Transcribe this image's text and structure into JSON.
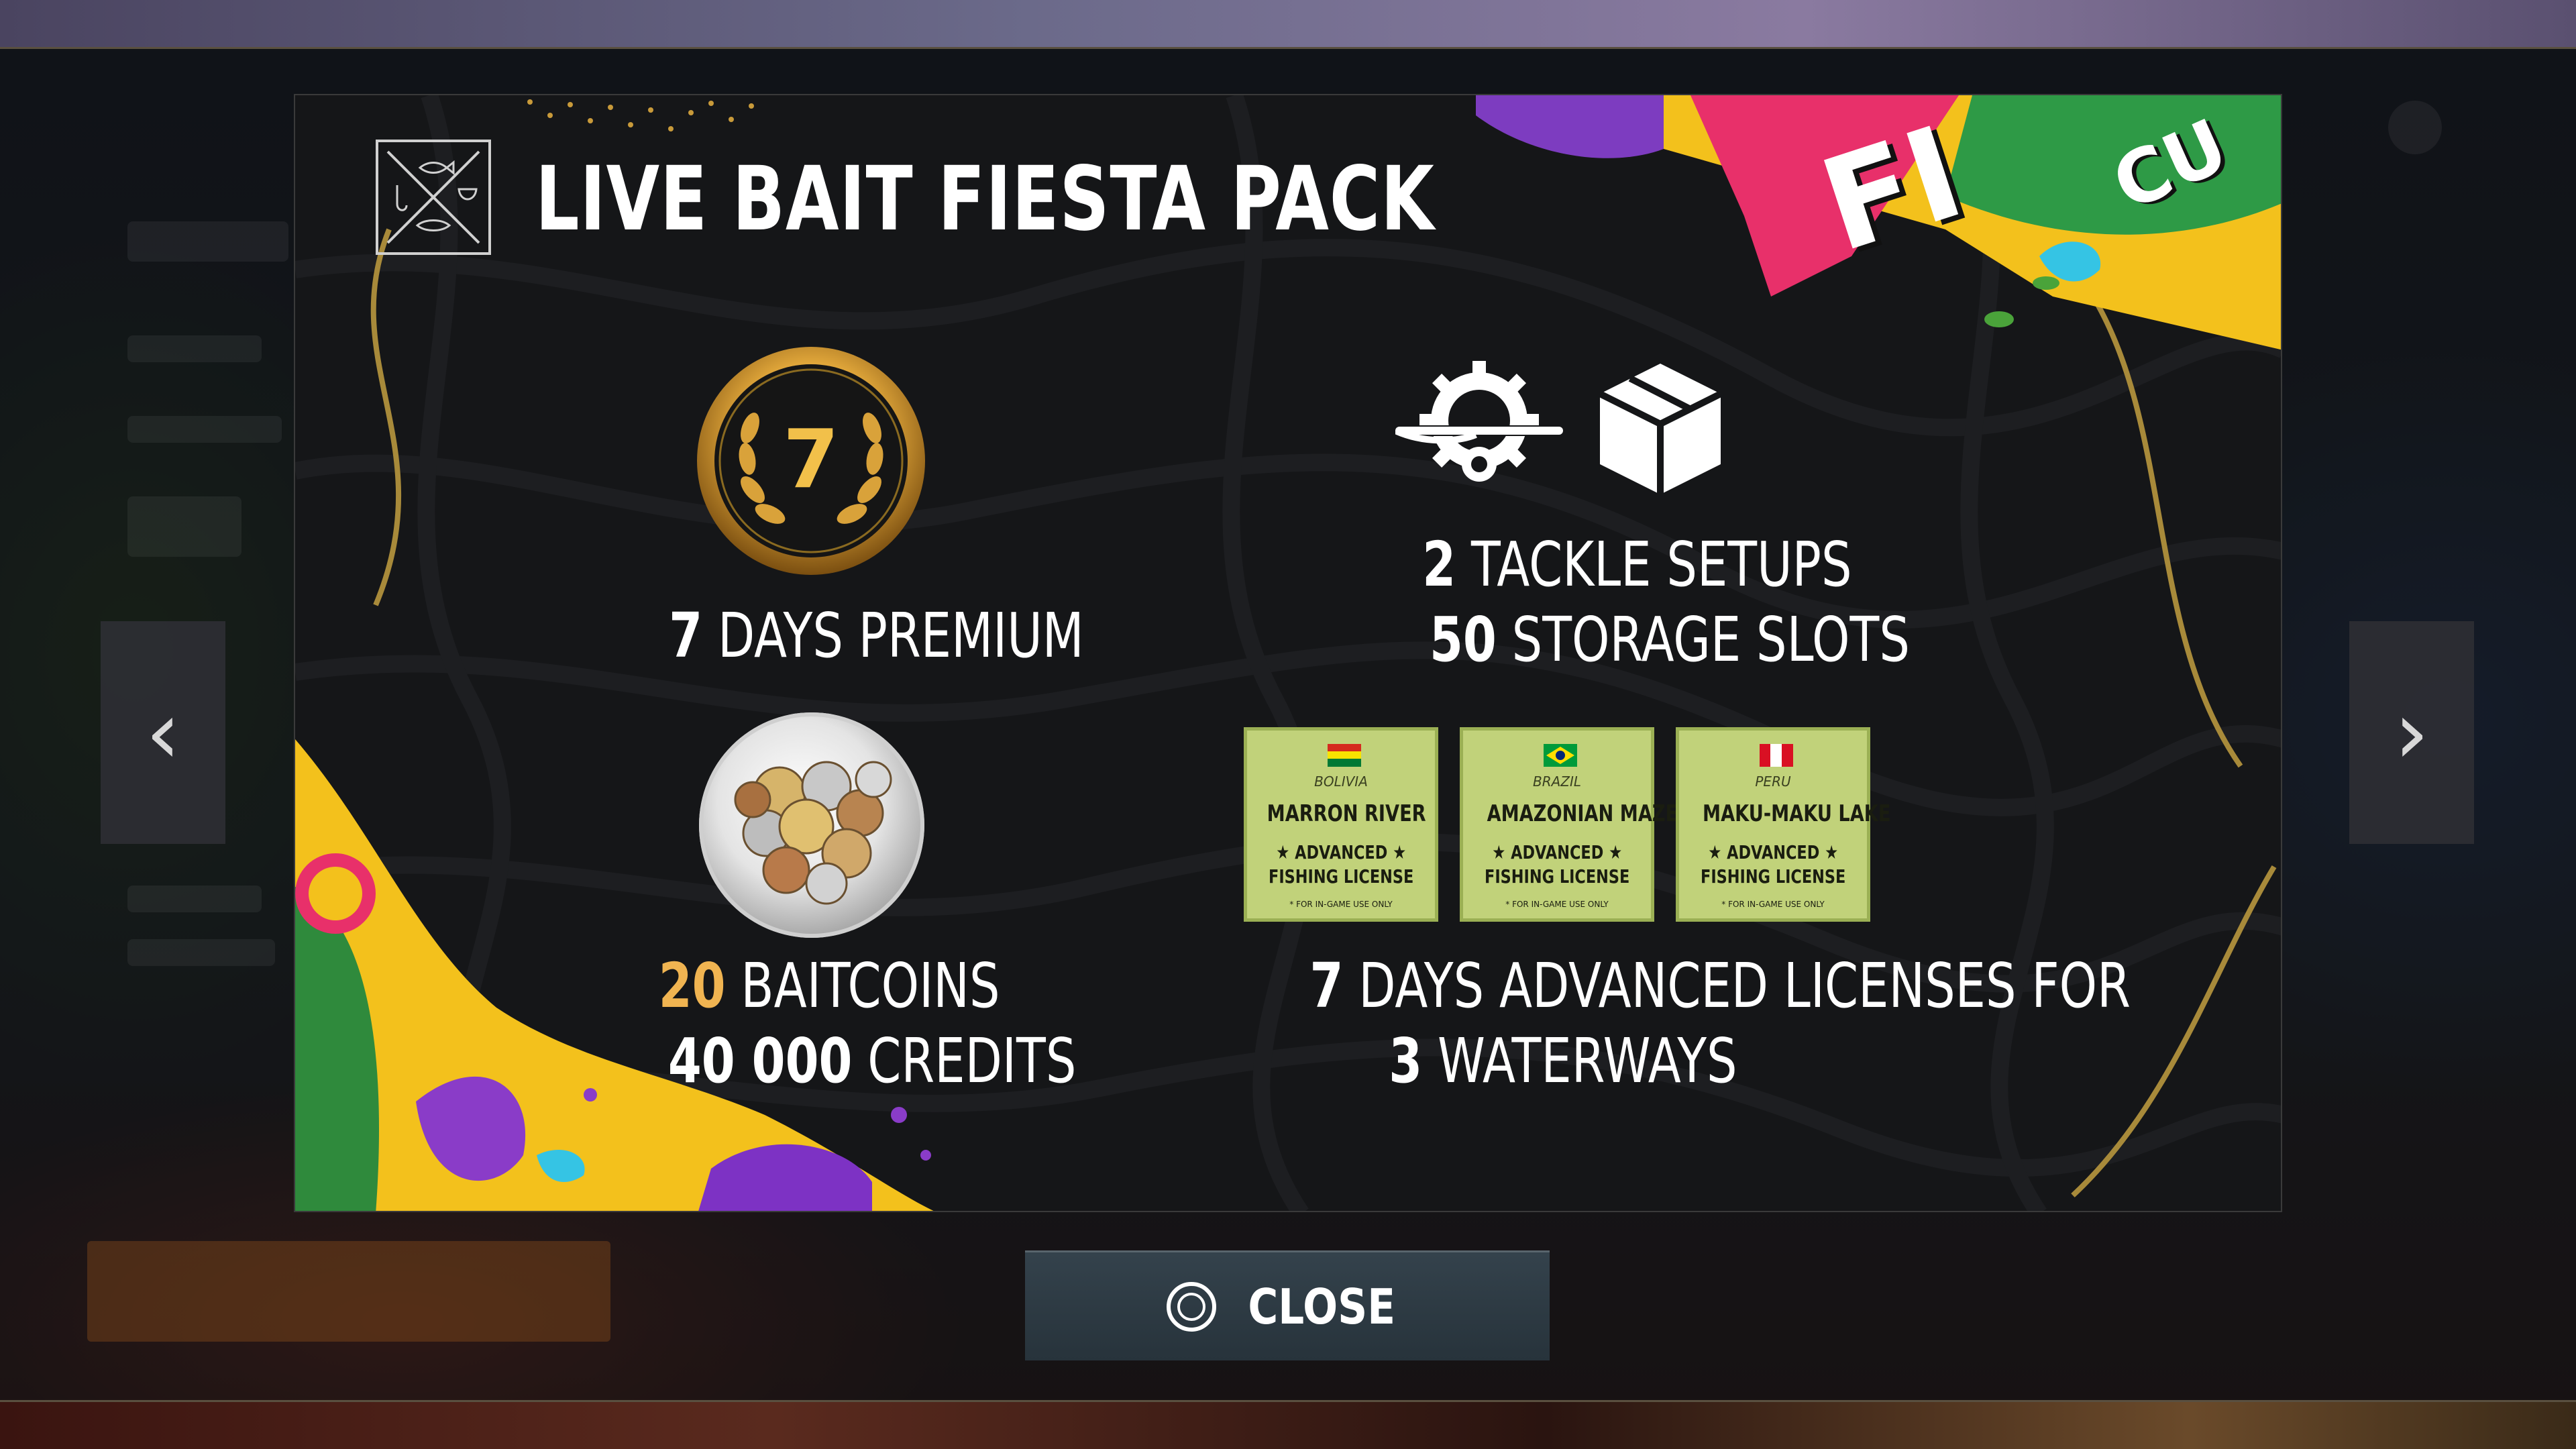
{
  "pack": {
    "title": "LIVE BAIT FIESTA PACK",
    "banner_text": "FI",
    "banner_text_2": "CU"
  },
  "rewards": {
    "premium": {
      "medal_number": "7",
      "days": "7",
      "label": "DAYS PREMIUM"
    },
    "storage": {
      "tackle_count": "2",
      "tackle_label": "TACKLE SETUPS",
      "slot_count": "50",
      "slot_label": "STORAGE SLOTS"
    },
    "currency": {
      "baitcoins_amount": "20",
      "baitcoins_label": "BAITCOINS",
      "credits_amount": "40 000",
      "credits_label": "CREDITS"
    },
    "licenses": {
      "days": "7",
      "line1_rest": "DAYS ADVANCED LICENSES FOR",
      "waterways_count": "3",
      "waterways_label": "WATERWAYS",
      "items": [
        {
          "country": "BOLIVIA",
          "name": "MARRON RIVER",
          "adv1": "★ ADVANCED ★",
          "adv2": "FISHING LICENSE",
          "fine": "* FOR IN-GAME USE ONLY"
        },
        {
          "country": "BRAZIL",
          "name": "AMAZONIAN MAZE",
          "adv1": "★ ADVANCED ★",
          "adv2": "FISHING LICENSE",
          "fine": "* FOR IN-GAME USE ONLY"
        },
        {
          "country": "PERU",
          "name": "MAKU-MAKU LAKE",
          "adv1": "★ ADVANCED ★",
          "adv2": "FISHING LICENSE",
          "fine": "* FOR IN-GAME USE ONLY"
        }
      ]
    }
  },
  "navigation": {
    "prev_glyph": "‹",
    "next_glyph": "›"
  },
  "close_button": {
    "label": "CLOSE"
  },
  "colors": {
    "accent_gold": "#f0b451",
    "license_bg": "#c1d27a",
    "banner_pink": "#e8306a",
    "banner_yellow": "#f3c11c"
  },
  "icons": [
    "fishing-emblem-icon",
    "premium-medal-icon",
    "tackle-setup-icon",
    "storage-box-icon",
    "coins-icon",
    "chevron-left-icon",
    "chevron-right-icon",
    "circle-button-icon"
  ]
}
